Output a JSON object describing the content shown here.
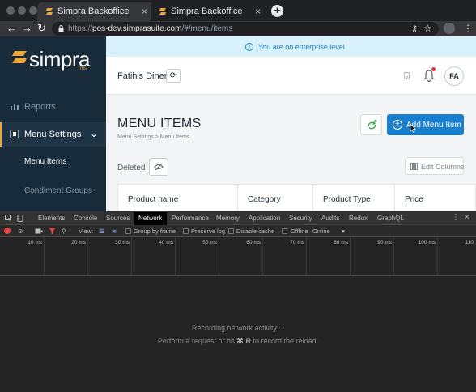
{
  "browser": {
    "tabs": [
      {
        "title": "Simpra Backoffice",
        "active": true
      },
      {
        "title": "Simpra Backoffice",
        "active": false
      }
    ],
    "new_tab": "+",
    "url_scheme": "https://",
    "url_host": "pos-dev.simprasuite.com",
    "url_path": "/#/menu/items"
  },
  "brand": {
    "name": "simpra",
    "suffix": "rms",
    "accent": "#f3a533"
  },
  "sidebar": {
    "items": [
      {
        "label": "Reports",
        "icon": "bar-chart-icon"
      },
      {
        "label": "Menu Settings",
        "icon": "menu-book-icon",
        "active": true
      },
      {
        "label": "Menu Items"
      },
      {
        "label": "Condiment Groups"
      }
    ]
  },
  "banner": {
    "text": "You are on enterprise level",
    "color": "#1c7fc4"
  },
  "header": {
    "restaurant": "Fatih's Diner",
    "avatar": "FA"
  },
  "main": {
    "title": "MENU ITEMS",
    "breadcrumb": "Menu Settings > Menu Items",
    "add_button": "Add Menu Item",
    "deleted_label": "Deleted",
    "edit_columns": "Edit Columns",
    "columns": [
      "Product name",
      "Category",
      "Product Type",
      "Price"
    ],
    "primary_color": "#1b7fd0"
  },
  "devtools": {
    "tabs": [
      "Elements",
      "Console",
      "Sources",
      "Network",
      "Performance",
      "Memory",
      "Application",
      "Security",
      "Audits",
      "Redux",
      "GraphQL"
    ],
    "active_tab": "Network",
    "toolbar": {
      "view": "View:",
      "group_by_frame": "Group by frame",
      "preserve_log": "Preserve log",
      "disable_cache": "Disable cache",
      "offline": "Offline",
      "throttle": "Online"
    },
    "timeline_ticks": [
      "10 ms",
      "20 ms",
      "30 ms",
      "40 ms",
      "50 ms",
      "60 ms",
      "70 ms",
      "80 ms",
      "90 ms",
      "100 ms",
      "110"
    ],
    "message1": "Recording network activity…",
    "message2_prefix": "Perform a request or hit",
    "message2_keys": "⌘ R",
    "message2_suffix": "to record the reload."
  }
}
